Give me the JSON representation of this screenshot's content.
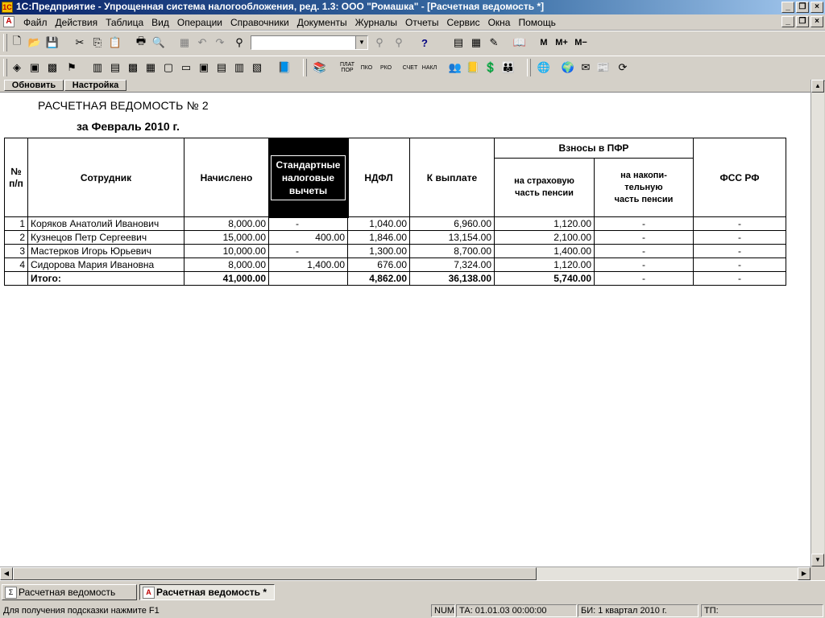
{
  "window": {
    "title": "1С:Предприятие - Упрощенная система налогообложения, ред. 1.3: ООО \"Ромашка\" - [Расчетная ведомость  *]"
  },
  "menu": [
    "Файл",
    "Действия",
    "Таблица",
    "Вид",
    "Операции",
    "Справочники",
    "Документы",
    "Журналы",
    "Отчеты",
    "Сервис",
    "Окна",
    "Помощь"
  ],
  "toolbar": {
    "m_label": "М",
    "mplus_label": "М+",
    "mminus_label": "М−",
    "doc_buttons": [
      {
        "line1": "ПЛАТ",
        "line2": "ПОР"
      },
      {
        "line1": "ПКО",
        "line2": ""
      },
      {
        "line1": "РКО",
        "line2": ""
      },
      {
        "line1": "СЧЕТ",
        "line2": ""
      },
      {
        "line1": "НАКЛ",
        "line2": ""
      }
    ]
  },
  "report_toolbar": {
    "refresh_label": "Обновить",
    "settings_label": "Настройка"
  },
  "report": {
    "title": "РАСЧЕТНАЯ ВЕДОМОСТЬ № 2",
    "period": "за Февраль 2010 г.",
    "headers": {
      "num": "№\nп/п",
      "employee": "Сотрудник",
      "accrued": "Начислено",
      "deductions": "Стандартные налоговые вычеты",
      "ndfl": "НДФЛ",
      "payout": "К выплате",
      "pfr": "Взносы в ПФР",
      "pfr_insurance": "на страховую\nчасть пенсии",
      "pfr_funded": "на накопи-\nтельную\nчасть пенсии",
      "fss": "ФСС РФ"
    },
    "rows": [
      {
        "n": "1",
        "name": "Коряков Анатолий Иванович",
        "accrued": "8,000.00",
        "deductions": "-",
        "ndfl": "1,040.00",
        "payout": "6,960.00",
        "pfr_ins": "1,120.00",
        "pfr_fund": "-",
        "fss": "-"
      },
      {
        "n": "2",
        "name": "Кузнецов Петр Сергеевич",
        "accrued": "15,000.00",
        "deductions": "400.00",
        "ndfl": "1,846.00",
        "payout": "13,154.00",
        "pfr_ins": "2,100.00",
        "pfr_fund": "-",
        "fss": "-"
      },
      {
        "n": "3",
        "name": "Мастерков Игорь Юрьевич",
        "accrued": "10,000.00",
        "deductions": "-",
        "ndfl": "1,300.00",
        "payout": "8,700.00",
        "pfr_ins": "1,400.00",
        "pfr_fund": "-",
        "fss": "-"
      },
      {
        "n": "4",
        "name": "Сидорова Мария Ивановна",
        "accrued": "8,000.00",
        "deductions": "1,400.00",
        "ndfl": "676.00",
        "payout": "7,324.00",
        "pfr_ins": "1,120.00",
        "pfr_fund": "-",
        "fss": "-"
      }
    ],
    "total": {
      "label": "Итого:",
      "accrued": "41,000.00",
      "deductions": "",
      "ndfl": "4,862.00",
      "payout": "36,138.00",
      "pfr_ins": "5,740.00",
      "pfr_fund": "-",
      "fss": "-"
    }
  },
  "tasks": [
    {
      "label": "Расчетная ведомость"
    },
    {
      "label": "Расчетная ведомость  *"
    }
  ],
  "status": {
    "hint": "Для получения подсказки нажмите F1",
    "num": "NUM",
    "ta": "ТА: 01.01.03  00:00:00",
    "bi": "БИ: 1 квартал 2010 г.",
    "tp": "ТП:"
  },
  "colors": {
    "title_bar": "#0a246a",
    "face": "#d4d0c8",
    "header_highlight": "#000000"
  }
}
